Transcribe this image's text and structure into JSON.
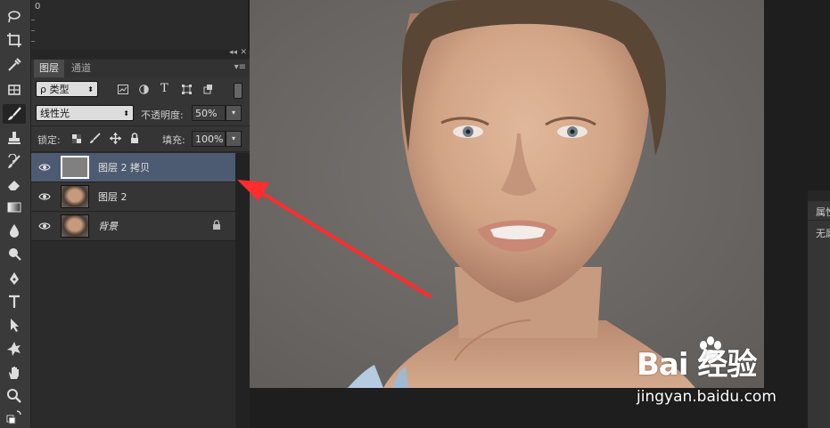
{
  "ruler": {
    "origin": "0"
  },
  "toolbar": {
    "tools": [
      "lasso-icon",
      "crop-icon",
      "eyedropper-icon",
      "patch-icon",
      "brush-icon",
      "stamp-icon",
      "history-brush-icon",
      "eraser-icon",
      "gradient-icon",
      "blur-icon",
      "dodge-icon",
      "pen-icon",
      "type-icon",
      "path-select-icon",
      "shape-icon",
      "hand-icon",
      "zoom-icon",
      "color-swap-icon"
    ]
  },
  "layers_panel": {
    "tabs": [
      {
        "label": "图层",
        "active": true
      },
      {
        "label": "通道",
        "active": false
      }
    ],
    "filter": {
      "kind_label": "ρ 类型"
    },
    "blend_mode": "线性光",
    "opacity_label": "不透明度:",
    "opacity_value": "50%",
    "lock_label": "锁定:",
    "fill_label": "填充:",
    "fill_value": "100%",
    "layers": [
      {
        "name": "图层 2 拷贝",
        "selected": true,
        "thumb": "gray",
        "locked": false
      },
      {
        "name": "图层 2",
        "selected": false,
        "thumb": "face",
        "locked": false
      },
      {
        "name": "背景",
        "selected": false,
        "thumb": "face",
        "locked": true
      }
    ]
  },
  "properties_panel": {
    "title": "属性",
    "subtitle": "无属"
  },
  "watermark": {
    "brand": "Bai 经验",
    "url": "jingyan.baidu.com"
  },
  "colors": {
    "accent": "#ff3333",
    "selected_layer": "#4d5b72"
  }
}
